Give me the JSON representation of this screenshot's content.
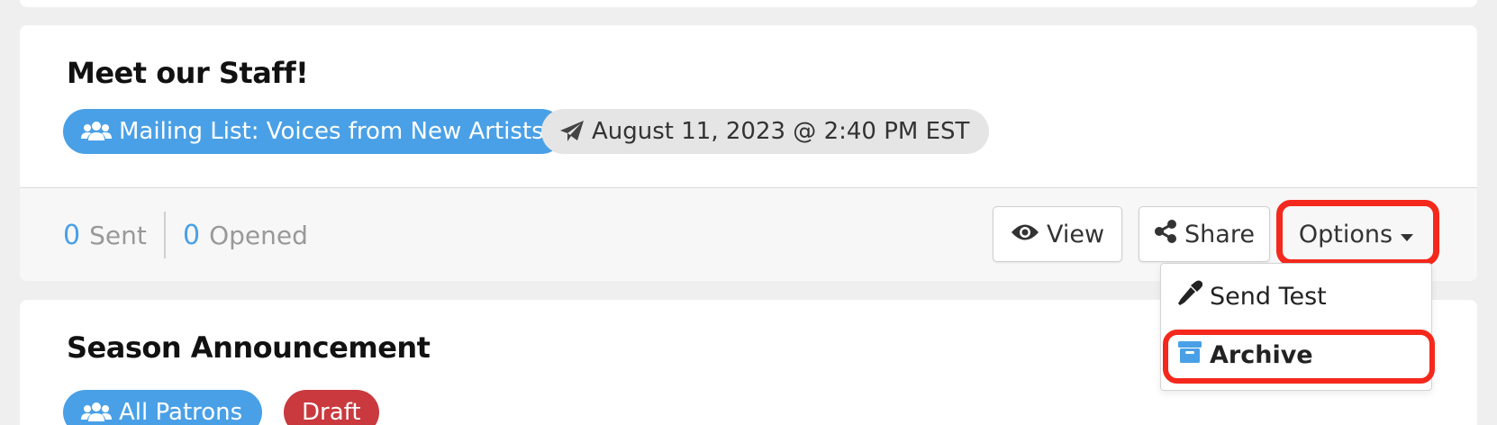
{
  "cards": [
    {
      "title": "Meet our Staff!",
      "list_badge": "Mailing List: Voices from New Artists",
      "schedule_badge": "August 11, 2023 @ 2:40 PM EST",
      "stats": {
        "sent_count": "0",
        "sent_label": "Sent",
        "opened_count": "0",
        "opened_label": "Opened"
      },
      "actions": {
        "view_label": "View",
        "share_label": "Share",
        "options_label": "Options"
      },
      "options_menu": {
        "items": [
          {
            "label": "Send Test",
            "icon": "eyedropper-icon"
          },
          {
            "label": "Archive",
            "icon": "archive-box-icon"
          }
        ]
      }
    },
    {
      "title": "Season Announcement",
      "list_badge": "All Patrons",
      "status_badge": "Draft"
    }
  ],
  "colors": {
    "accent_blue": "#4aa0e6",
    "draft_red": "#c9393e",
    "highlight_red": "#f4281c"
  }
}
